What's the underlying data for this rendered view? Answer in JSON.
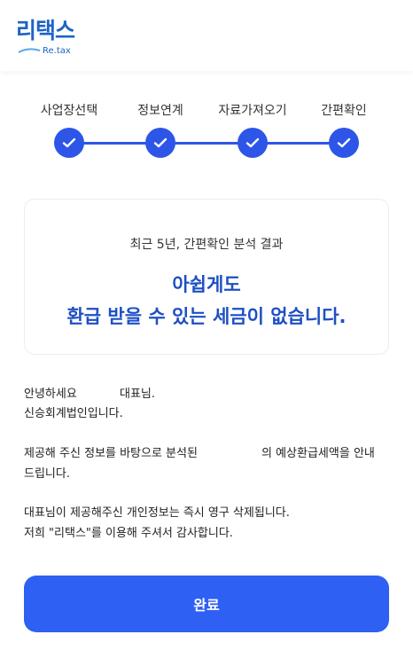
{
  "brand": {
    "logo_text": "리택스",
    "logo_sub": "Re.tax",
    "color": "#1e63c7"
  },
  "steps": [
    {
      "label": "사업장선택",
      "status": "done",
      "icon": "check-icon"
    },
    {
      "label": "정보연계",
      "status": "done",
      "icon": "check-icon"
    },
    {
      "label": "자료가져오기",
      "status": "done",
      "icon": "check-icon"
    },
    {
      "label": "간편확인",
      "status": "done",
      "icon": "check-icon"
    }
  ],
  "result": {
    "subtitle": "최근 5년, 간편확인 분석 결과",
    "title_line1": "아쉽게도",
    "title_line2": "환급 받을 수 있는 세금이 없습니다."
  },
  "message": {
    "greeting_1": "안녕하세요",
    "greeting_2": "대표님.",
    "firm": "신승회계법인입니다.",
    "analysis_1": "제공해 주신 정보를 바탕으로 분석된",
    "analysis_2": "의 예상환급세액을 안내",
    "analysis_3": "드립니다.",
    "privacy_1": "대표님이 제공해주신 개인정보는 즉시 영구 삭제됩니다.",
    "privacy_2": "저희 \"리택스\"를 이용해 주셔서 감사합니다."
  },
  "actions": {
    "done_label": "완료"
  },
  "colors": {
    "accent": "#2d56e8",
    "button": "#2f60f4",
    "title": "#1e4fc4"
  }
}
